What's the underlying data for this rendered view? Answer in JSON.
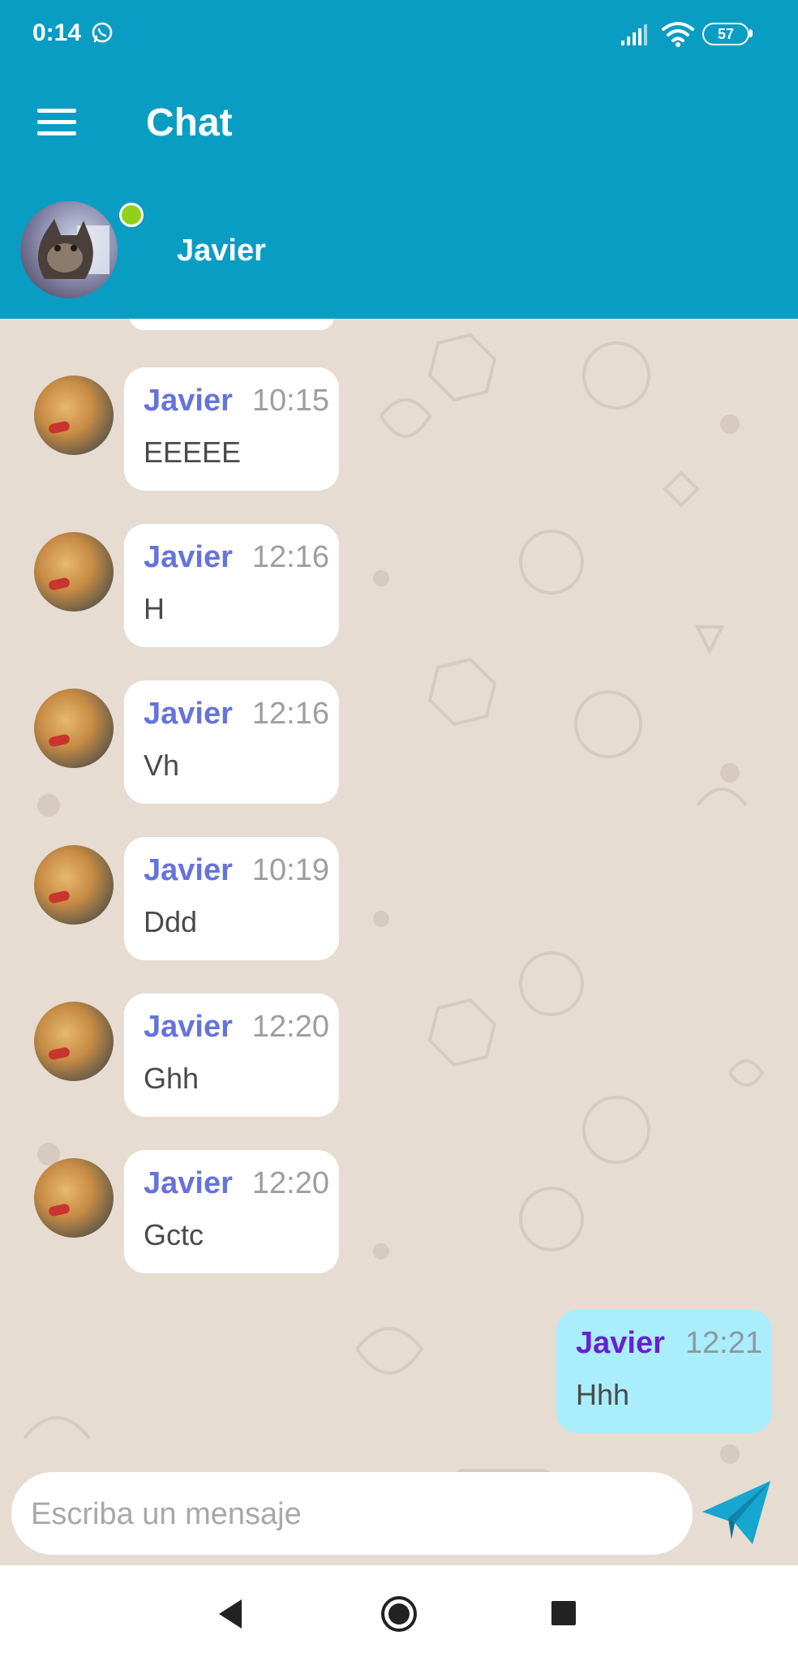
{
  "status_bar": {
    "time": "0:14",
    "battery": "57",
    "icons": [
      "whatsapp-icon",
      "signal-icon",
      "wifi-icon",
      "battery-icon"
    ]
  },
  "app_bar": {
    "title": "Chat",
    "menu_icon": "menu-icon",
    "contact_name": "Javier",
    "online_color": "#8fd11b"
  },
  "colors": {
    "primary": "#0a9dc3",
    "incoming_bubble": "#ffffff",
    "outgoing_bubble": "#aaedfc",
    "incoming_name": "#6673db",
    "outgoing_name": "#6a1fd2"
  },
  "messages": [
    {
      "sender": "Javier",
      "time": "10:15",
      "text": "EEEEE"
    },
    {
      "sender": "Javier",
      "time": "12:16",
      "text": "H"
    },
    {
      "sender": "Javier",
      "time": "12:16",
      "text": "Vh"
    },
    {
      "sender": "Javier",
      "time": "10:19",
      "text": "Ddd"
    },
    {
      "sender": "Javier",
      "time": "12:20",
      "text": "Ghh"
    },
    {
      "sender": "Javier",
      "time": "12:20",
      "text": "Gctc"
    }
  ],
  "outgoing_message": {
    "sender": "Javier",
    "time": "12:21",
    "text": "Hhh"
  },
  "composer": {
    "placeholder": "Escriba un mensaje",
    "send_icon": "send-icon"
  },
  "nav_bar": {
    "icons": [
      "back-icon",
      "home-icon",
      "recents-icon"
    ]
  }
}
